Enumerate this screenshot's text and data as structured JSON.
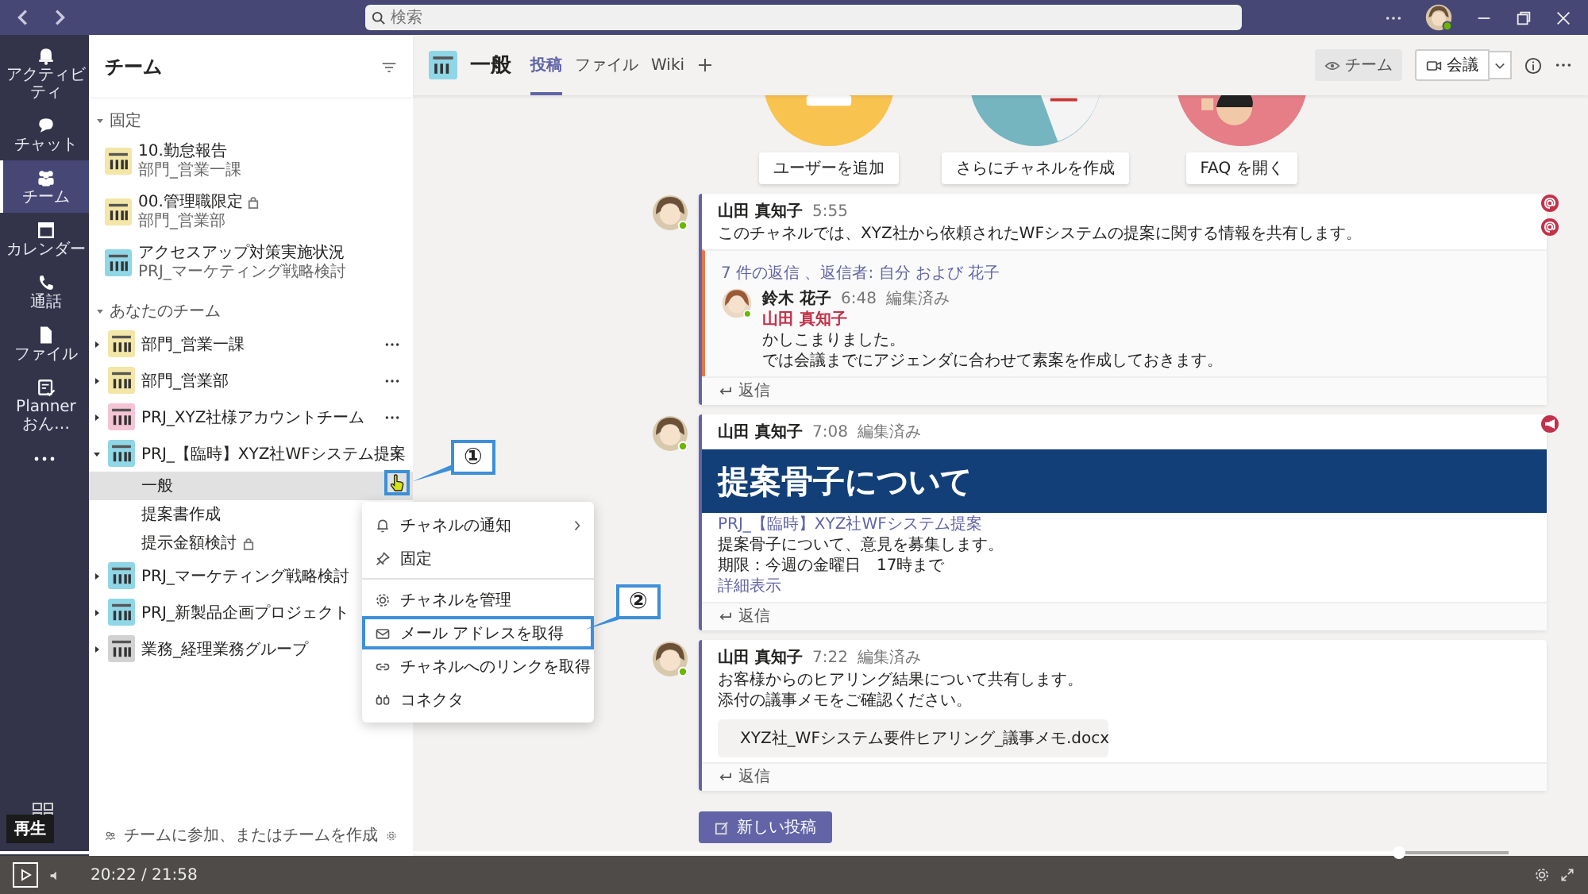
{
  "titlebar": {
    "search_placeholder": "検索",
    "user_online": true
  },
  "rail": [
    {
      "label": "アクティビティ",
      "selected": false
    },
    {
      "label": "チャット",
      "selected": false
    },
    {
      "label": "チーム",
      "selected": true
    },
    {
      "label": "カレンダー",
      "selected": false
    },
    {
      "label": "通話",
      "selected": false
    },
    {
      "label": "ファイル",
      "selected": false
    },
    {
      "label": "Planner おん…",
      "selected": false
    }
  ],
  "sidebar": {
    "title": "チーム",
    "sections": [
      {
        "label": "固定",
        "expanded": true,
        "teams": [
          {
            "name": "10.勤怠報告",
            "subtitle": "部門_営業一課",
            "color": "#f3e6a6"
          },
          {
            "name": "00.管理職限定",
            "subtitle": "部門_営業部",
            "color": "#f3e6a6",
            "locked": true
          },
          {
            "name": "アクセスアップ対策実施状況",
            "subtitle": "PRJ_マーケティング戦略検討",
            "color": "#8fd6e6"
          }
        ]
      },
      {
        "label": "あなたのチーム",
        "expanded": true,
        "teams": [
          {
            "name": "部門_営業一課",
            "color": "#f3e6a6",
            "expanded": false
          },
          {
            "name": "部門_営業部",
            "color": "#f3e6a6",
            "expanded": false
          },
          {
            "name": "PRJ_XYZ社様アカウントチーム",
            "color": "#f5c4d4",
            "expanded": false
          },
          {
            "name": "PRJ_【臨時】XYZ社WFシステム提案",
            "color": "#8fd6e6",
            "expanded": true,
            "channels": [
              {
                "name": "一般",
                "selected": true,
                "callout": "①"
              },
              {
                "name": "提案書作成",
                "selected": false
              },
              {
                "name": "提示金額検討",
                "selected": false,
                "locked": true
              }
            ]
          },
          {
            "name": "PRJ_マーケティング戦略検討",
            "color": "#8fd6e6",
            "expanded": false
          },
          {
            "name": "PRJ_新製品企画プロジェクト",
            "color": "#8fd6e6",
            "expanded": false
          },
          {
            "name": "業務_経理業務グループ",
            "color": "#d2d2d2",
            "expanded": false
          }
        ]
      }
    ],
    "footer": "チームに参加、またはチームを作成"
  },
  "context_menu": {
    "items": [
      {
        "kind": "item",
        "label": "チャネルの通知",
        "submenu": true
      },
      {
        "kind": "item",
        "label": "固定",
        "submenu": false
      },
      {
        "kind": "divider"
      },
      {
        "kind": "item",
        "label": "チャネルを管理",
        "submenu": false
      },
      {
        "kind": "item",
        "label": "メール アドレスを取得",
        "submenu": false,
        "callout": "②"
      },
      {
        "kind": "item",
        "label": "チャネルへのリンクを取得",
        "submenu": false
      },
      {
        "kind": "item",
        "label": "コネクタ",
        "submenu": false
      }
    ]
  },
  "channel_header": {
    "name": "一般",
    "tabs": [
      {
        "label": "投稿",
        "selected": true
      },
      {
        "label": "ファイル",
        "selected": false
      },
      {
        "label": "Wiki",
        "selected": false
      }
    ],
    "team_button": "チーム",
    "meet_button": "会議"
  },
  "welcome_buttons": [
    "ユーザーを追加",
    "さらにチャネルを作成",
    "FAQ を開く"
  ],
  "posts": [
    {
      "author": "山田 真知子",
      "time": "5:55",
      "online": true,
      "lines": [
        "このチャネルでは、XYZ社から依頼されたWFシステムの提案に関する情報を共有します。"
      ],
      "flags": [
        {
          "kind": "mention"
        },
        {
          "kind": "mention"
        }
      ],
      "thread": {
        "summary": "7 件の返信 、返信者: 自分 および 花子",
        "reply": {
          "author": "鈴木 花子",
          "time": "6:48",
          "edited": "編集済み",
          "online": true,
          "mention": "山田 真知子",
          "lines": [
            "かしこまりました。",
            "では会議までにアジェンダに合わせて素案を作成しておきます。"
          ]
        }
      },
      "reply_button": "返信"
    },
    {
      "author": "山田 真知子",
      "time": "7:08",
      "edited": "編集済み",
      "online": true,
      "banner": "提案骨子について",
      "link": "PRJ_【臨時】XYZ社WFシステム提案",
      "lines": [
        "提案骨子について、意見を募集します。",
        "期限：今週の金曜日　17時まで"
      ],
      "more": "詳細表示",
      "flags": [
        {
          "kind": "announcement"
        }
      ],
      "reply_button": "返信"
    },
    {
      "author": "山田 真知子",
      "time": "7:22",
      "edited": "編集済み",
      "online": true,
      "lines": [
        "お客様からのヒアリング結果について共有します。",
        "添付の議事メモをご確認ください。"
      ],
      "file": "XYZ社_WFシステム要件ヒアリング_議事メモ.docx",
      "reply_button": "返信"
    }
  ],
  "new_post_button": "新しい投稿",
  "player": {
    "tooltip": "再生",
    "time": "20:22 / 21:58",
    "level": 0.927
  }
}
